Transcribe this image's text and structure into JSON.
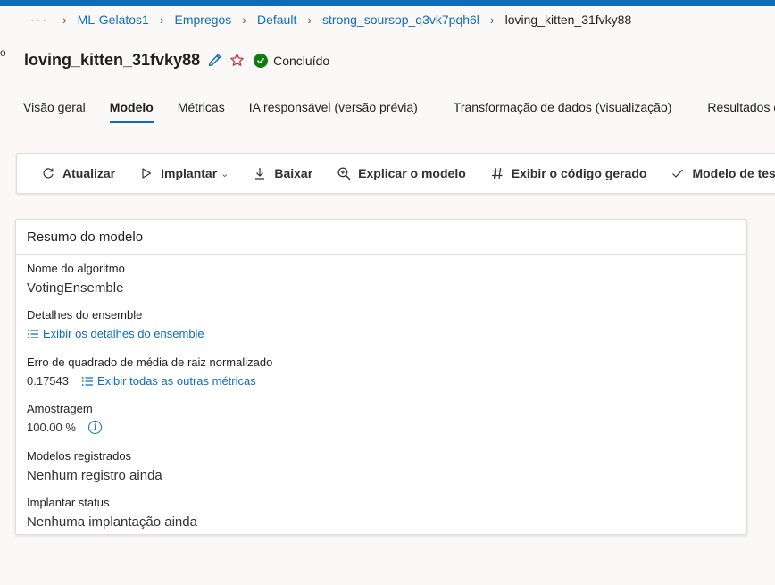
{
  "left_edge_text": "o",
  "breadcrumb": {
    "more": "···",
    "items": [
      "ML-Gelatos1",
      "Empregos",
      "Default",
      "strong_soursop_q3vk7pqh6l"
    ],
    "current": "loving_kitten_31fvky88"
  },
  "header": {
    "title": "loving_kitten_31fvky88",
    "status": "Concluído",
    "status_color": "#107c10"
  },
  "tabs": [
    {
      "label": "Visão geral",
      "active": false
    },
    {
      "label": "Modelo",
      "active": true
    },
    {
      "label": "Métricas",
      "active": false
    },
    {
      "label": "IA responsável (versão prévia)",
      "active": false
    },
    {
      "label": "Transformação de dados (visualização)",
      "active": false
    },
    {
      "label": "Resultados do",
      "active": false
    }
  ],
  "commands": {
    "refresh": {
      "label": "Atualizar",
      "icon": "refresh-icon"
    },
    "deploy": {
      "label": "Implantar",
      "icon": "play-icon"
    },
    "download": {
      "label": "Baixar",
      "icon": "download-icon"
    },
    "explain": {
      "label": "Explicar o modelo",
      "icon": "search-icon"
    },
    "code": {
      "label": "Exibir o código gerado",
      "icon": "hash-icon"
    },
    "test": {
      "label": "Modelo de teste",
      "icon": "check-icon"
    }
  },
  "summary": {
    "title": "Resumo do modelo",
    "algorithm_label": "Nome do algoritmo",
    "algorithm_value": "VotingEnsemble",
    "ensemble_label": "Detalhes do ensemble",
    "ensemble_link": "Exibir os detalhes do ensemble",
    "metric_label": "Erro de quadrado de média de raiz normalizado",
    "metric_value": "0.17543",
    "metric_link": "Exibir todas as outras métricas",
    "sampling_label": "Amostragem",
    "sampling_value": "100.00 %",
    "registered_label": "Modelos registrados",
    "registered_value": "Nenhum registro ainda",
    "deploy_label": "Implantar status",
    "deploy_value": "Nenhuma implantação ainda"
  },
  "colors": {
    "accent": "#0f6cbd",
    "star": "#c4314b"
  }
}
